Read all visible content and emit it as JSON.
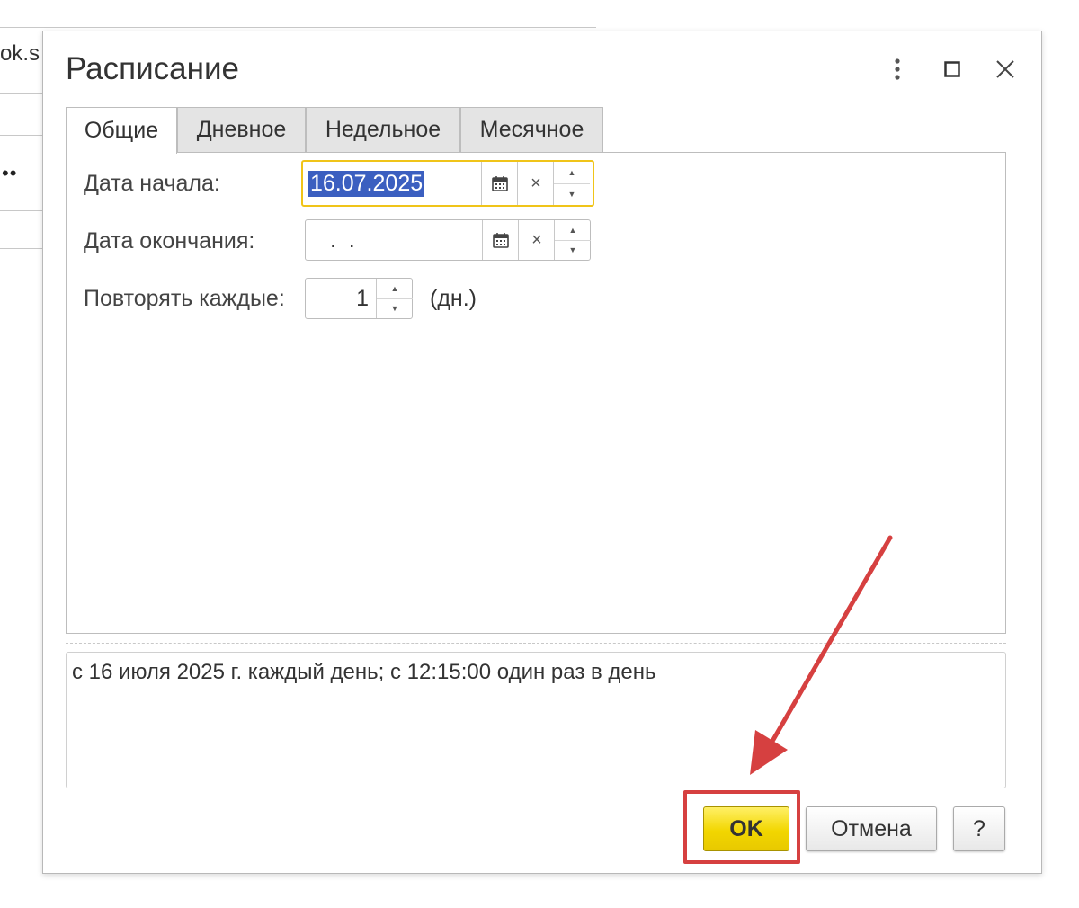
{
  "background": {
    "text_fragment": "ok.s",
    "dots": "••"
  },
  "dialog": {
    "title": "Расписание"
  },
  "tabs": [
    {
      "label": "Общие",
      "active": true
    },
    {
      "label": "Дневное",
      "active": false
    },
    {
      "label": "Недельное",
      "active": false
    },
    {
      "label": "Месячное",
      "active": false
    }
  ],
  "general": {
    "start_date_label": "Дата начала:",
    "start_date_value": "16.07.2025",
    "end_date_label": "Дата окончания:",
    "end_date_value": " .  .",
    "repeat_label": "Повторять каждые:",
    "repeat_value": "1",
    "repeat_unit": "(дн.)"
  },
  "summary_text": "с 16 июля 2025 г. каждый день; с 12:15:00 один раз в день",
  "buttons": {
    "ok": "OK",
    "cancel": "Отмена",
    "help": "?"
  },
  "icons": {
    "clear": "×",
    "spin_up": "▲",
    "spin_down": "▼"
  },
  "colors": {
    "ok_button": "#f2d600",
    "focus_border": "#f0c419",
    "selection": "#3b5fc0",
    "annotation": "#d64040"
  }
}
